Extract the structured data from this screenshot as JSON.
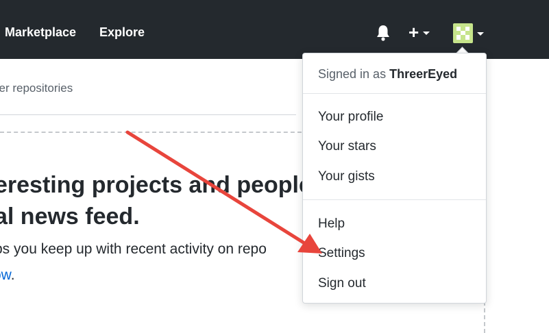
{
  "header": {
    "nav": [
      {
        "label": "Marketplace"
      },
      {
        "label": "Explore"
      }
    ],
    "icons": [
      "bell-icon",
      "plus-icon",
      "avatar"
    ],
    "background": "#24292e"
  },
  "main": {
    "subtitle": "ver repositories",
    "hero": {
      "line1": "eresting projects and people",
      "line2": "al news feed."
    },
    "description": "ps you keep up with recent activity on repo",
    "follow_link": "ow",
    "follow_suffix": "."
  },
  "dropdown": {
    "signed_in_prefix": "Signed in as",
    "username": "ThreerEyed",
    "group1": [
      {
        "label": "Your profile"
      },
      {
        "label": "Your stars"
      },
      {
        "label": "Your gists"
      }
    ],
    "group2": [
      {
        "label": "Help"
      },
      {
        "label": "Settings"
      },
      {
        "label": "Sign out"
      }
    ]
  },
  "colors": {
    "accent_link": "#0366d6",
    "annotation_arrow": "#e8453c",
    "avatar": "#c6e48b"
  }
}
